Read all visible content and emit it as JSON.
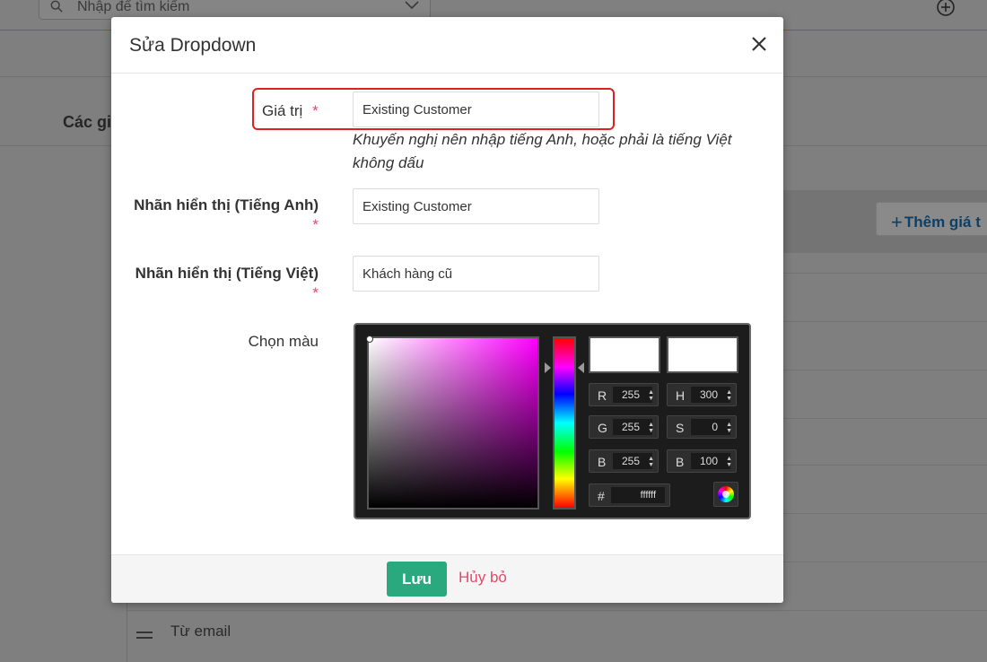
{
  "background": {
    "search_placeholder": "Nhập để tìm kiếm",
    "section_heading": "Các giá",
    "add_value_label": "Thêm giá t",
    "last_row_label": "Từ email"
  },
  "modal": {
    "title": "Sửa Dropdown",
    "fields": {
      "value": {
        "label": "Giá trị",
        "required_mark": "*",
        "value": "Existing Customer"
      },
      "hint": "Khuyến nghị nên nhập tiếng Anh, hoặc phải là tiếng Việt không dấu",
      "label_en": {
        "label": "Nhãn hiển thị (Tiếng Anh)",
        "required_mark": "*",
        "value": "Existing Customer"
      },
      "label_vi": {
        "label": "Nhãn hiển thị (Tiếng Việt)",
        "required_mark": "*",
        "value": "Khách hàng cũ"
      },
      "color": {
        "label": "Chọn màu"
      }
    },
    "color_picker": {
      "current_color": "#ffffff",
      "r_label": "R",
      "r": "255",
      "g_label": "G",
      "g": "255",
      "b_label": "B",
      "b": "255",
      "h_label": "H",
      "h": "300",
      "s_label": "S",
      "s": "0",
      "v_label": "B",
      "v": "100",
      "hex_label": "#",
      "hex": "ffffff"
    },
    "footer": {
      "save_label": "Lưu",
      "cancel_label": "Hủy bỏ"
    }
  },
  "colors": {
    "primary_button": "#2aa87e",
    "danger_text": "#e04a6a",
    "highlight_border": "#e02020"
  }
}
